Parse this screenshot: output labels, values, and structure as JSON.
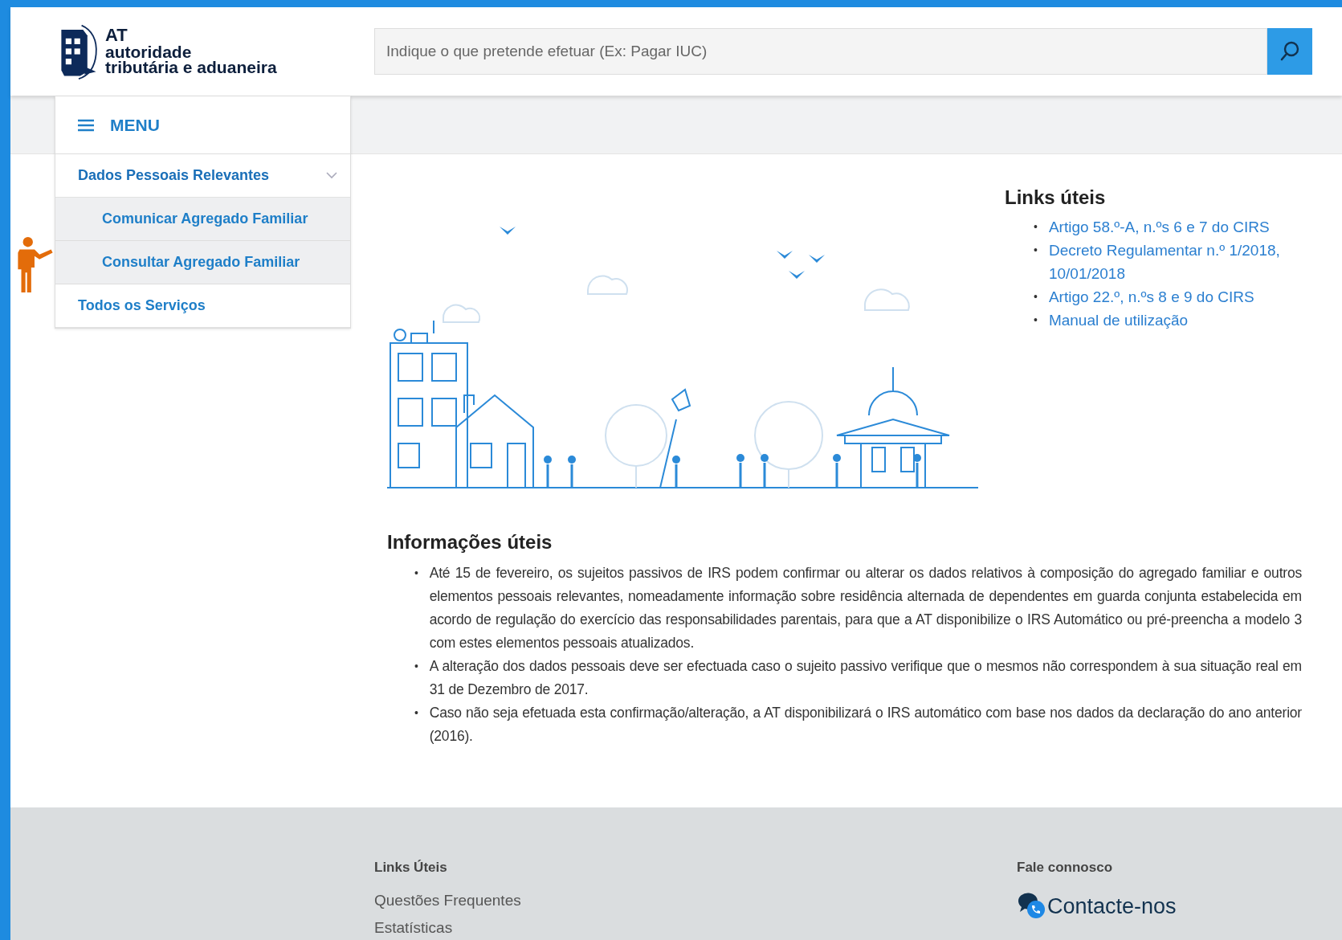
{
  "header": {
    "logo": {
      "abbr": "AT",
      "line_1": "autoridade",
      "line_2": "tributária e aduaneira"
    },
    "search": {
      "placeholder": "Indique o que pretende efetuar (Ex: Pagar IUC)"
    }
  },
  "menu": {
    "title": "MENU",
    "items": [
      {
        "label": "Dados Pessoais Relevantes",
        "expanded": true,
        "children": [
          {
            "label": "Comunicar Agregado Familiar"
          },
          {
            "label": "Consultar Agregado Familiar"
          }
        ]
      },
      {
        "label": "Todos os Serviços",
        "expanded": false
      }
    ]
  },
  "links": {
    "title": "Links úteis",
    "bullet": "•",
    "items": [
      "Artigo 58.º-A, n.ºs 6 e 7 do CIRS",
      "Decreto Regulamentar n.º 1/2018, 10/01/2018",
      "Artigo 22.º, n.ºs 8 e 9 do CIRS",
      "Manual de utilização"
    ]
  },
  "info": {
    "title": "Informações úteis",
    "bullet": "•",
    "items": [
      "Até 15 de fevereiro, os sujeitos passivos de IRS podem confirmar ou alterar os dados relativos à composição do agregado familiar e outros elementos pessoais relevantes, nomeadamente informação sobre residência alternada de dependentes em guarda conjunta estabelecida em acordo de regulação do exercício das responsabilidades parentais, para que a AT disponibilize o IRS Automático ou pré-preencha a modelo 3 com estes elementos pessoais atualizados.",
      "A alteração dos dados pessoais deve ser efectuada caso o sujeito passivo verifique que o mesmos não correspondem à sua situação real em 31 de Dezembro de 2017.",
      "Caso não seja efetuada esta confirmação/alteração, a AT disponibilizará o IRS automático com base nos dados da declaração do ano anterior (2016)."
    ]
  },
  "footer": {
    "columns": [
      {
        "title": "Links Úteis",
        "links": [
          "Questões Frequentes",
          "Estatísticas"
        ]
      },
      {
        "title": "Fale connosco",
        "contact": "Contacte-nos"
      }
    ]
  }
}
